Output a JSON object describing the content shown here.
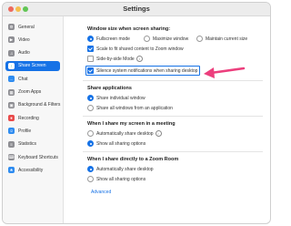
{
  "window": {
    "title": "Settings"
  },
  "colors": {
    "accent": "#1672e6",
    "annotation_arrow": "#ec3f7d"
  },
  "sidebar": {
    "items": [
      {
        "label": "General",
        "icon": "gear-icon",
        "color": "#8e8e93",
        "active": false
      },
      {
        "label": "Video",
        "icon": "video-camera-icon",
        "color": "#8e8e93",
        "active": false
      },
      {
        "label": "Audio",
        "icon": "headphones-icon",
        "color": "#8e8e93",
        "active": false
      },
      {
        "label": "Share Screen",
        "icon": "share-screen-icon",
        "color": "#2fbf71",
        "active": true
      },
      {
        "label": "Chat",
        "icon": "chat-icon",
        "color": "#2f8cf0",
        "active": false
      },
      {
        "label": "Zoom Apps",
        "icon": "apps-icon",
        "color": "#8e8e93",
        "active": false
      },
      {
        "label": "Background & Filters",
        "icon": "background-icon",
        "color": "#8e8e93",
        "active": false
      },
      {
        "label": "Recording",
        "icon": "recording-icon",
        "color": "#e94b4b",
        "active": false
      },
      {
        "label": "Profile",
        "icon": "profile-icon",
        "color": "#2f8cf0",
        "active": false
      },
      {
        "label": "Statistics",
        "icon": "statistics-icon",
        "color": "#8e8e93",
        "active": false
      },
      {
        "label": "Keyboard Shortcuts",
        "icon": "keyboard-icon",
        "color": "#8e8e93",
        "active": false
      },
      {
        "label": "Accessibility",
        "icon": "accessibility-icon",
        "color": "#2f8cf0",
        "active": false
      }
    ]
  },
  "window_size": {
    "title": "Window size when screen sharing:",
    "modes": [
      {
        "label": "Fullscreen mode",
        "selected": true
      },
      {
        "label": "Maximize window",
        "selected": false
      },
      {
        "label": "Maintain current size",
        "selected": false
      }
    ],
    "scale_to_fit": {
      "label": "Scale to fit shared content to Zoom window",
      "checked": true
    },
    "side_by_side": {
      "label": "Side-by-side Mode",
      "checked": false
    },
    "silence_notifications": {
      "label": "Silence system notifications when sharing desktop",
      "checked": true
    }
  },
  "share_applications": {
    "title": "Share applications",
    "options": [
      {
        "label": "Share individual window",
        "selected": true
      },
      {
        "label": "Share all windows from an application",
        "selected": false
      }
    ]
  },
  "share_in_meeting": {
    "title": "When I share my screen in a meeting",
    "options": [
      {
        "label": "Automatically share desktop",
        "selected": false
      },
      {
        "label": "Show all sharing options",
        "selected": true
      }
    ]
  },
  "share_to_room": {
    "title": "When I share directly to a Zoom Room",
    "options": [
      {
        "label": "Automatically share desktop",
        "selected": true
      },
      {
        "label": "Show all sharing options",
        "selected": false
      }
    ]
  },
  "advanced_link": "Advanced"
}
